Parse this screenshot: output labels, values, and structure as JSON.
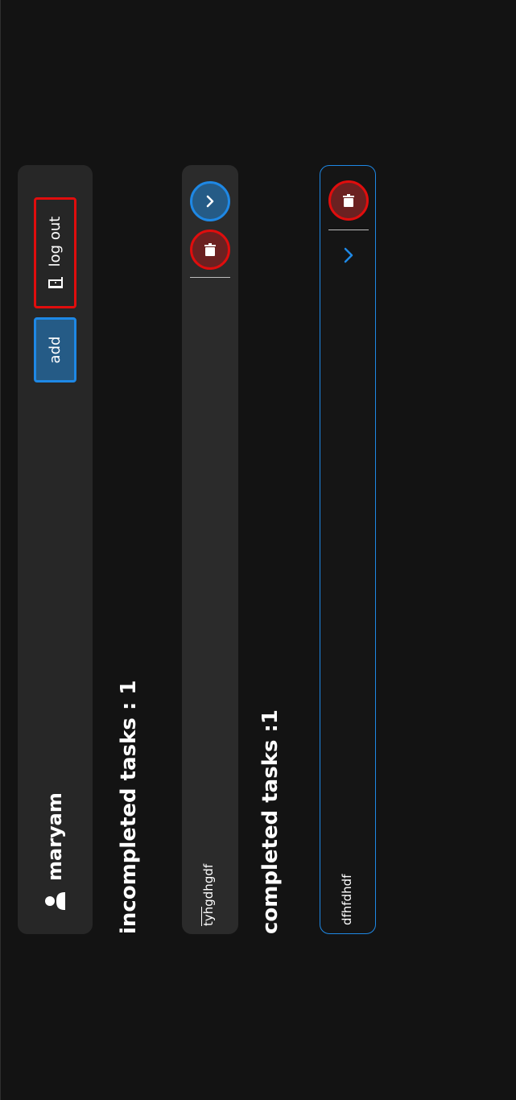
{
  "header": {
    "username": "maryam",
    "add_label": "add",
    "logout_label": "log out"
  },
  "incomplete": {
    "title": "incompleted tasks : 1",
    "tasks": [
      {
        "text": "tyhgdhgdf"
      }
    ]
  },
  "complete": {
    "title": "completed tasks :1",
    "tasks": [
      {
        "text": "dfhfdhdf"
      }
    ]
  },
  "icons": {
    "user": "user-icon",
    "logout": "door-exit-icon",
    "delete": "trash-icon",
    "complete": "chevron-right-icon"
  },
  "colors": {
    "background": "#131313",
    "panel": "#272727",
    "accent_blue": "#1e88e5",
    "accent_red": "#e00d0d",
    "text": "#ffffff"
  }
}
